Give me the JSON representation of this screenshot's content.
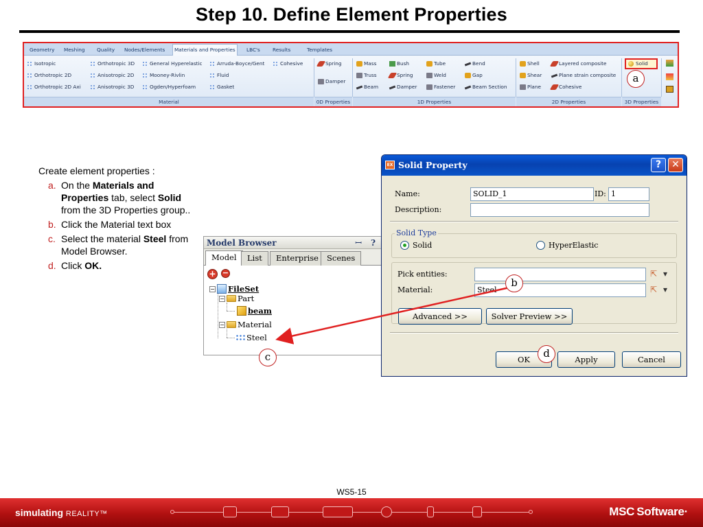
{
  "slide": {
    "title": "Step 10. Define Element Properties",
    "page_number": "WS5-15"
  },
  "ribbon": {
    "tabs": [
      "Geometry",
      "Meshing",
      "Quality",
      "Nodes/Elements",
      "Materials and Properties",
      "LBC's",
      "Results",
      "Templates"
    ],
    "active_tab": "Materials and Properties",
    "material_items": [
      "Isotropic",
      "Orthotropic 2D",
      "Orthotropic 2D Axi",
      "Orthotropic 3D",
      "Anisotropic 2D",
      "Anisotropic 3D",
      "General Hyperelastic",
      "Mooney-Rivlin",
      "Ogden/Hyperfoam",
      "Arruda-Boyce/Gent",
      "Fluid",
      "Gasket",
      "Cohesive"
    ],
    "zero_d_items": [
      "Spring",
      "Damper"
    ],
    "one_d_items": [
      "Mass",
      "Truss",
      "Beam",
      "Bush",
      "Spring",
      "Damper",
      "Tube",
      "Weld",
      "Fastener",
      "Bend",
      "Gap",
      "Beam Section"
    ],
    "two_d_items": [
      "Shell",
      "Shear",
      "Plane",
      "Layered composite",
      "Plane strain composite",
      "Cohesive"
    ],
    "three_d_items": [
      "Solid"
    ],
    "groups": [
      "Material",
      "0D Properties",
      "1D Properties",
      "2D Properties",
      "3D Properties"
    ]
  },
  "instructions": {
    "intro": "Create element properties :",
    "steps": [
      {
        "label": "a.",
        "parts": [
          "On the ",
          "Materials and Properties",
          " tab, select ",
          "Solid",
          " from the 3D Properties group.."
        ]
      },
      {
        "label": "b.",
        "parts": [
          "Click the Material text box"
        ]
      },
      {
        "label": "c.",
        "parts": [
          "Select the material ",
          "Steel",
          " from Model Browser."
        ]
      },
      {
        "label": "d.",
        "parts": [
          "Click ",
          "OK."
        ]
      }
    ]
  },
  "model_browser": {
    "title": "Model Browser",
    "pin": "ȣ",
    "help": "?",
    "tabs": [
      "Model",
      "List",
      "Enterprise",
      "Scenes"
    ],
    "active_tab": "Model",
    "add_icon": "plus-icon",
    "remove_icon": "minus-icon",
    "tree": {
      "root": "FileSet",
      "part_folder": "Part",
      "part": "beam",
      "material_folder": "Material",
      "material": "Steel"
    }
  },
  "dialog": {
    "title": "Solid Property",
    "app_icon": "EX",
    "help_button": "?",
    "close_button": "✕",
    "name_label": "Name:",
    "name_value": "SOLID_1",
    "id_label": "ID:",
    "id_value": "1",
    "description_label": "Description:",
    "description_value": "",
    "solid_type_legend": "Solid Type",
    "solid_type_options": [
      "Solid",
      "HyperElastic"
    ],
    "solid_type_selected": "Solid",
    "pick_entities_label": "Pick entities:",
    "pick_entities_value": "",
    "material_label": "Material:",
    "material_value": "Steel",
    "advanced_button": "Advanced >>",
    "solver_preview_button": "Solver Preview >>",
    "ok_button": "OK",
    "apply_button": "Apply",
    "cancel_button": "Cancel"
  },
  "callouts": {
    "a": "a",
    "b": "b",
    "c": "c",
    "d": "d"
  },
  "footer": {
    "slogan_bold": "simulating",
    "slogan_thin": "REALITY™",
    "logo": "MSC Software·"
  },
  "colors": {
    "accent_red": "#e02020",
    "ribbon_bg": "#dde8f6",
    "dialog_title_blue": "#0742b0",
    "footer_red": "#b01010"
  }
}
